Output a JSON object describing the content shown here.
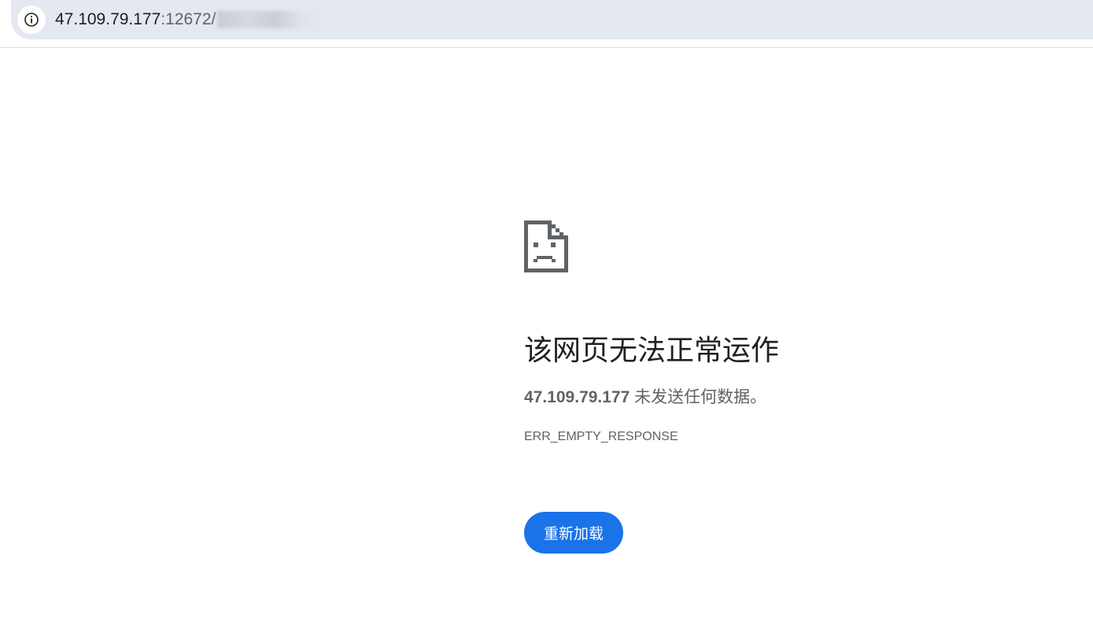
{
  "address_bar": {
    "host": "47.109.79.177",
    "port_path": ":12672/",
    "info_icon": "info-icon"
  },
  "error_page": {
    "icon": "sad-page-icon",
    "title": "该网页无法正常运作",
    "summary_host": "47.109.79.177",
    "summary_text": " 未发送任何数据。",
    "error_code": "ERR_EMPTY_RESPONSE",
    "reload_label": "重新加载",
    "button_color": "#1a73e8"
  }
}
